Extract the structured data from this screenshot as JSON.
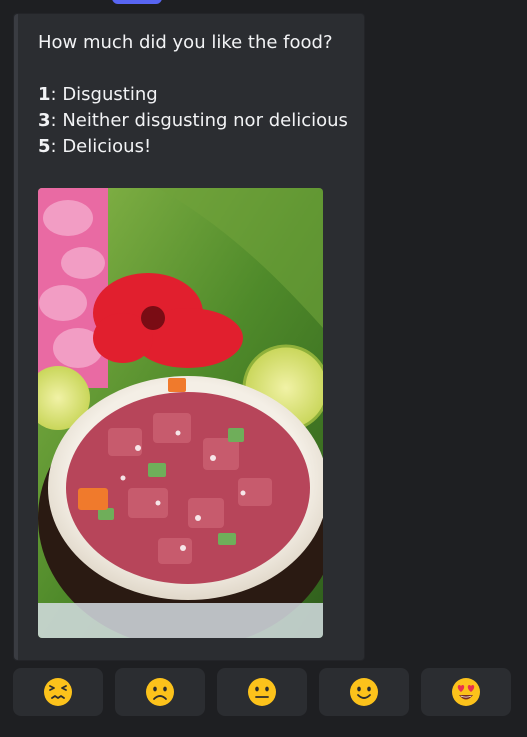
{
  "poll": {
    "question": "How much did you like the food?",
    "options": [
      {
        "num": "1",
        "text": ": Disgusting"
      },
      {
        "num": "3",
        "text": ": Neither disgusting nor delicious"
      },
      {
        "num": "5",
        "text": ": Delicious!"
      }
    ],
    "image_icon": "food-photo"
  },
  "buttons": [
    {
      "icon": "confounded-face-icon"
    },
    {
      "icon": "frowning-face-icon"
    },
    {
      "icon": "neutral-face-icon"
    },
    {
      "icon": "slightly-smiling-face-icon"
    },
    {
      "icon": "heart-eyes-face-icon"
    }
  ],
  "colors": {
    "background": "#1e1f22",
    "embed": "#2b2d31",
    "accent": "#5865f2",
    "emoji_yellow": "#fcc21b",
    "heart_red": "#e8314e"
  }
}
